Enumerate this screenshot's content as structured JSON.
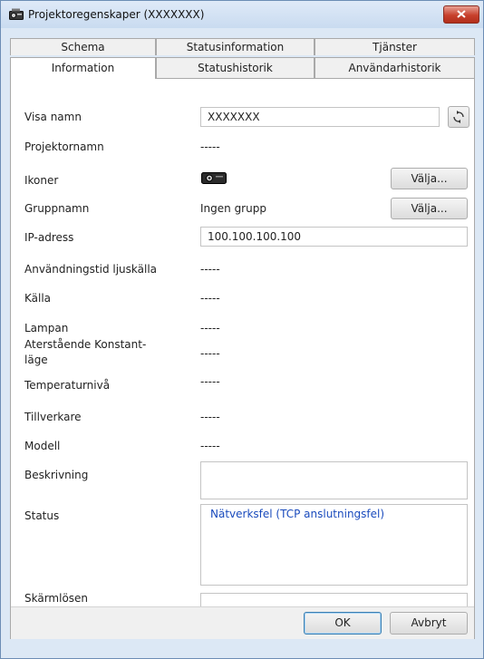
{
  "window": {
    "title": "Projektoregenskaper (XXXXXXX)"
  },
  "tabs_back": [
    "Schema",
    "Statusinformation",
    "Tjänster"
  ],
  "tabs_front": [
    "Information",
    "Statushistorik",
    "Användarhistorik"
  ],
  "active_tab": "Information",
  "fields": {
    "display_name": {
      "label": "Visa namn",
      "value": "XXXXXXX"
    },
    "projector_name": {
      "label": "Projektornamn",
      "value": "-----"
    },
    "icons": {
      "label": "Ikoner",
      "icon": "projector-icon",
      "button": "Välja..."
    },
    "group_name": {
      "label": "Gruppnamn",
      "value": "Ingen grupp",
      "button": "Välja..."
    },
    "ip_address": {
      "label": "IP-adress",
      "value": "100.100.100.100"
    },
    "light_source_hours": {
      "label": "Användningstid ljuskälla",
      "value": "-----"
    },
    "source": {
      "label": "Källa",
      "value": "-----"
    },
    "lamp": {
      "label": "Lampan",
      "value": "-----"
    },
    "remaining_constant_line1": "Aterstående Konstant-",
    "remaining_constant_line2": "läge",
    "remaining_constant_value": "-----",
    "temperature": {
      "label": "Temperaturnivå",
      "value": "-----"
    },
    "manufacturer": {
      "label": "Tillverkare",
      "value": "-----"
    },
    "model": {
      "label": "Modell",
      "value": "-----"
    },
    "description": {
      "label": "Beskrivning",
      "value": ""
    },
    "status": {
      "label": "Status",
      "value": "Nätverksfel (TCP anslutningsfel)"
    },
    "screen_password": {
      "label": "Skärmlösen",
      "value": ""
    }
  },
  "footer": {
    "ok": "OK",
    "cancel": "Avbryt"
  },
  "colors": {
    "status_text": "#1a4bbd",
    "close_button": "#c7402c",
    "title_bar": "#c9dbf0"
  }
}
